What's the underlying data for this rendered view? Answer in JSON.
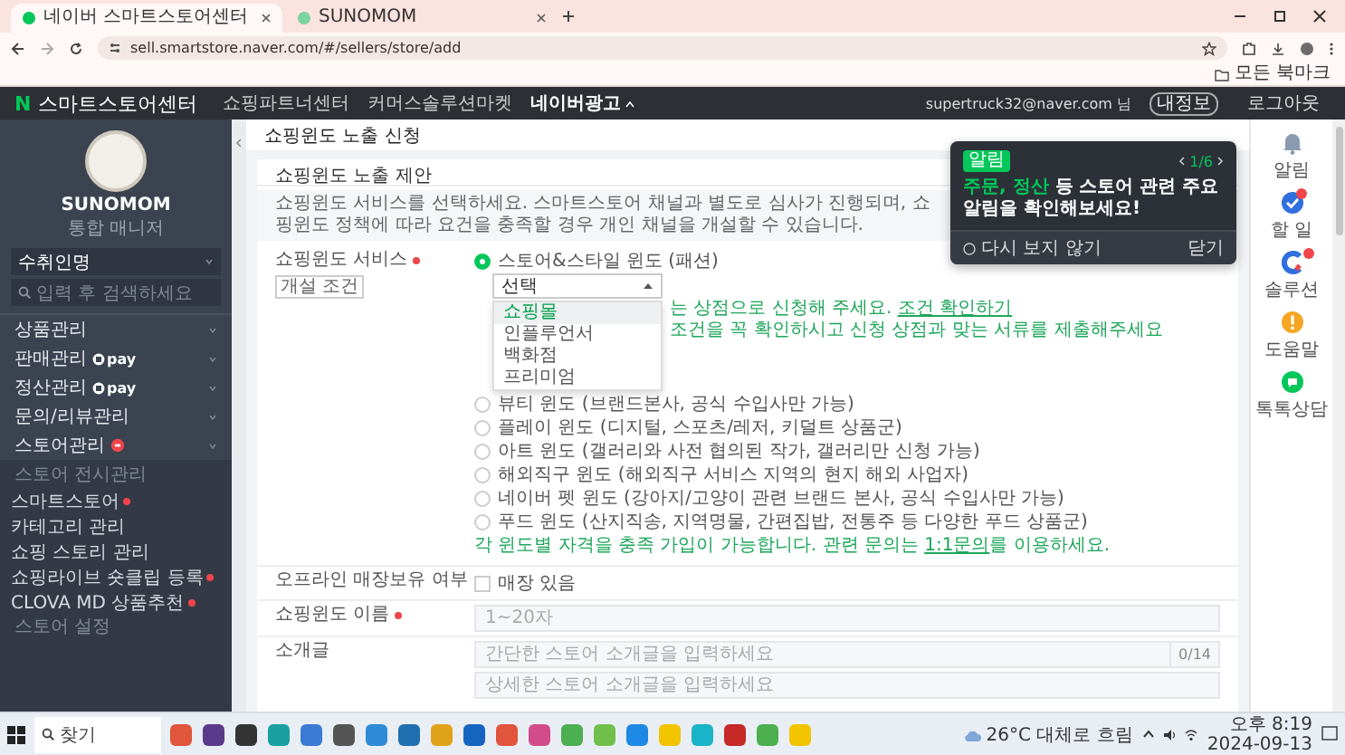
{
  "browser": {
    "tabs": [
      {
        "title": "네이버 스마트스토어센터",
        "selected": true
      },
      {
        "title": "SUNOMOM",
        "selected": false
      }
    ],
    "url": "sell.smartstore.naver.com/#/sellers/store/add",
    "bookmarks_label": "모든 북마크"
  },
  "header": {
    "logo_letter": "N",
    "title": "스마트스토어센터",
    "nav": [
      {
        "label": "쇼핑파트너센터",
        "kind": "link"
      },
      {
        "label": "커머스솔루션마켓",
        "kind": "link"
      },
      {
        "label": "네이버광고",
        "kind": "menu"
      }
    ],
    "user": "supertruck32@naver.com 님",
    "user_badge": "내정보",
    "logout": "로그아웃"
  },
  "sidebar": {
    "store_name": "SUNOMOM",
    "role": "통합 매니저",
    "search_select": "수취인명",
    "search_placeholder": "입력 후 검색하세요",
    "menu": [
      {
        "label": "상품관리",
        "kind": "plain"
      },
      {
        "label": "판매관리",
        "kind": "pay",
        "badge": "pay"
      },
      {
        "label": "정산관리",
        "kind": "pay",
        "badge": "pay"
      },
      {
        "label": "문의/리뷰관리",
        "kind": "plain"
      },
      {
        "label": "스토어관리",
        "kind": "alert"
      }
    ],
    "section_heading": "스토어 전시관리",
    "submenu": [
      {
        "label": "스마트스토어",
        "marked": true
      },
      {
        "label": "카테고리 관리",
        "marked": false
      },
      {
        "label": "쇼핑 스토리 관리",
        "marked": false
      },
      {
        "label": "쇼핑라이브 숏클립 등록",
        "marked": true
      },
      {
        "label": "CLOVA MD 상품추천",
        "marked": true
      }
    ],
    "next_heading": "스토어 설정"
  },
  "main": {
    "page_title": "쇼핑윈도 노출 신청",
    "card_title": "쇼핑윈도 노출 제안",
    "description": "쇼핑윈도 서비스를 선택하세요. 스마트스토어 채널과 별도로 심사가 진행되며, 쇼핑윈도 정책에 따라 요건을 충족할 경우 개인 채널을 개설할 수 있습니다.",
    "service": {
      "label": "쇼핑윈도 서비스",
      "required": true,
      "condition_tag": "개설 조건",
      "primary_option": {
        "label": "스토어&스타일 윈도 (패션)",
        "selected": true
      },
      "select": {
        "value": "선택",
        "expanded": true,
        "options": [
          {
            "label": "쇼핑몰",
            "selected": true
          },
          {
            "label": "인플루언서",
            "selected": false
          },
          {
            "label": "백화점",
            "selected": false
          },
          {
            "label": "프리미엄",
            "selected": false
          }
        ]
      },
      "hints": [
        {
          "text": "는 상점으로 신청해 주세요.",
          "link": "조건 확인하기"
        },
        {
          "text": "조건을 꼭 확인하시고 신청 상점과 맞는 서류를 제출해주세요"
        }
      ],
      "options": [
        {
          "label": "뷰티 윈도 (브랜드본사, 공식 수입사만 가능)",
          "selected": false
        },
        {
          "label": "플레이 윈도 (디지털, 스포츠/레저, 키덜트 상품군)",
          "selected": false
        },
        {
          "label": "아트 윈도 (갤러리와 사전 협의된 작가, 갤러리만 신청 가능)",
          "selected": false
        },
        {
          "label": "해외직구 윈도 (해외직구 서비스 지역의 현지 해외 사업자)",
          "selected": false
        },
        {
          "label": "네이버 펫 윈도 (강아지/고양이 관련 브랜드 본사, 공식 수입사만 가능)",
          "selected": false
        },
        {
          "label": "푸드 윈도 (산지직송, 지역명물, 간편집밥, 전통주 등 다양한 푸드 상품군)",
          "selected": false
        }
      ],
      "note": {
        "before": "각 윈도별 자격을 충족 가입이 가능합니다. 관련 문의는 ",
        "link": "1:1문의",
        "after": "를 이용하세요."
      }
    },
    "offline": {
      "label": "오프라인 매장보유 여부",
      "checkbox_label": "매장 있음",
      "checked": false
    },
    "name_field": {
      "label": "쇼핑윈도 이름",
      "required": true,
      "placeholder": "1~20자"
    },
    "intro": {
      "label": "소개글",
      "required": false,
      "short_placeholder": "간단한 스토어 소개글을 입력하세요",
      "counter": "0/14",
      "long_placeholder": "상세한 스토어 소개글을 입력하세요"
    }
  },
  "notification": {
    "badge": "알림",
    "pager": "1/6",
    "highlight": "주문, 정산",
    "message": " 등 스토어 관련 주요 알림을 확인해보세요!",
    "dismiss": "다시 보지 않기",
    "close": "닫기"
  },
  "right_rail": [
    {
      "label": "알림",
      "kind": "bell",
      "alert": false
    },
    {
      "label": "할 일",
      "kind": "todo",
      "alert": true
    },
    {
      "label": "솔루션",
      "kind": "solution",
      "alert": true
    },
    {
      "label": "도움말",
      "kind": "help",
      "alert": false
    },
    {
      "label": "톡톡상담",
      "kind": "chat",
      "alert": false
    }
  ],
  "taskbar": {
    "search_placeholder": "찾기",
    "weather": "26°C 대체로 흐림",
    "time": "오후 8:19",
    "date": "2024-09-13"
  }
}
